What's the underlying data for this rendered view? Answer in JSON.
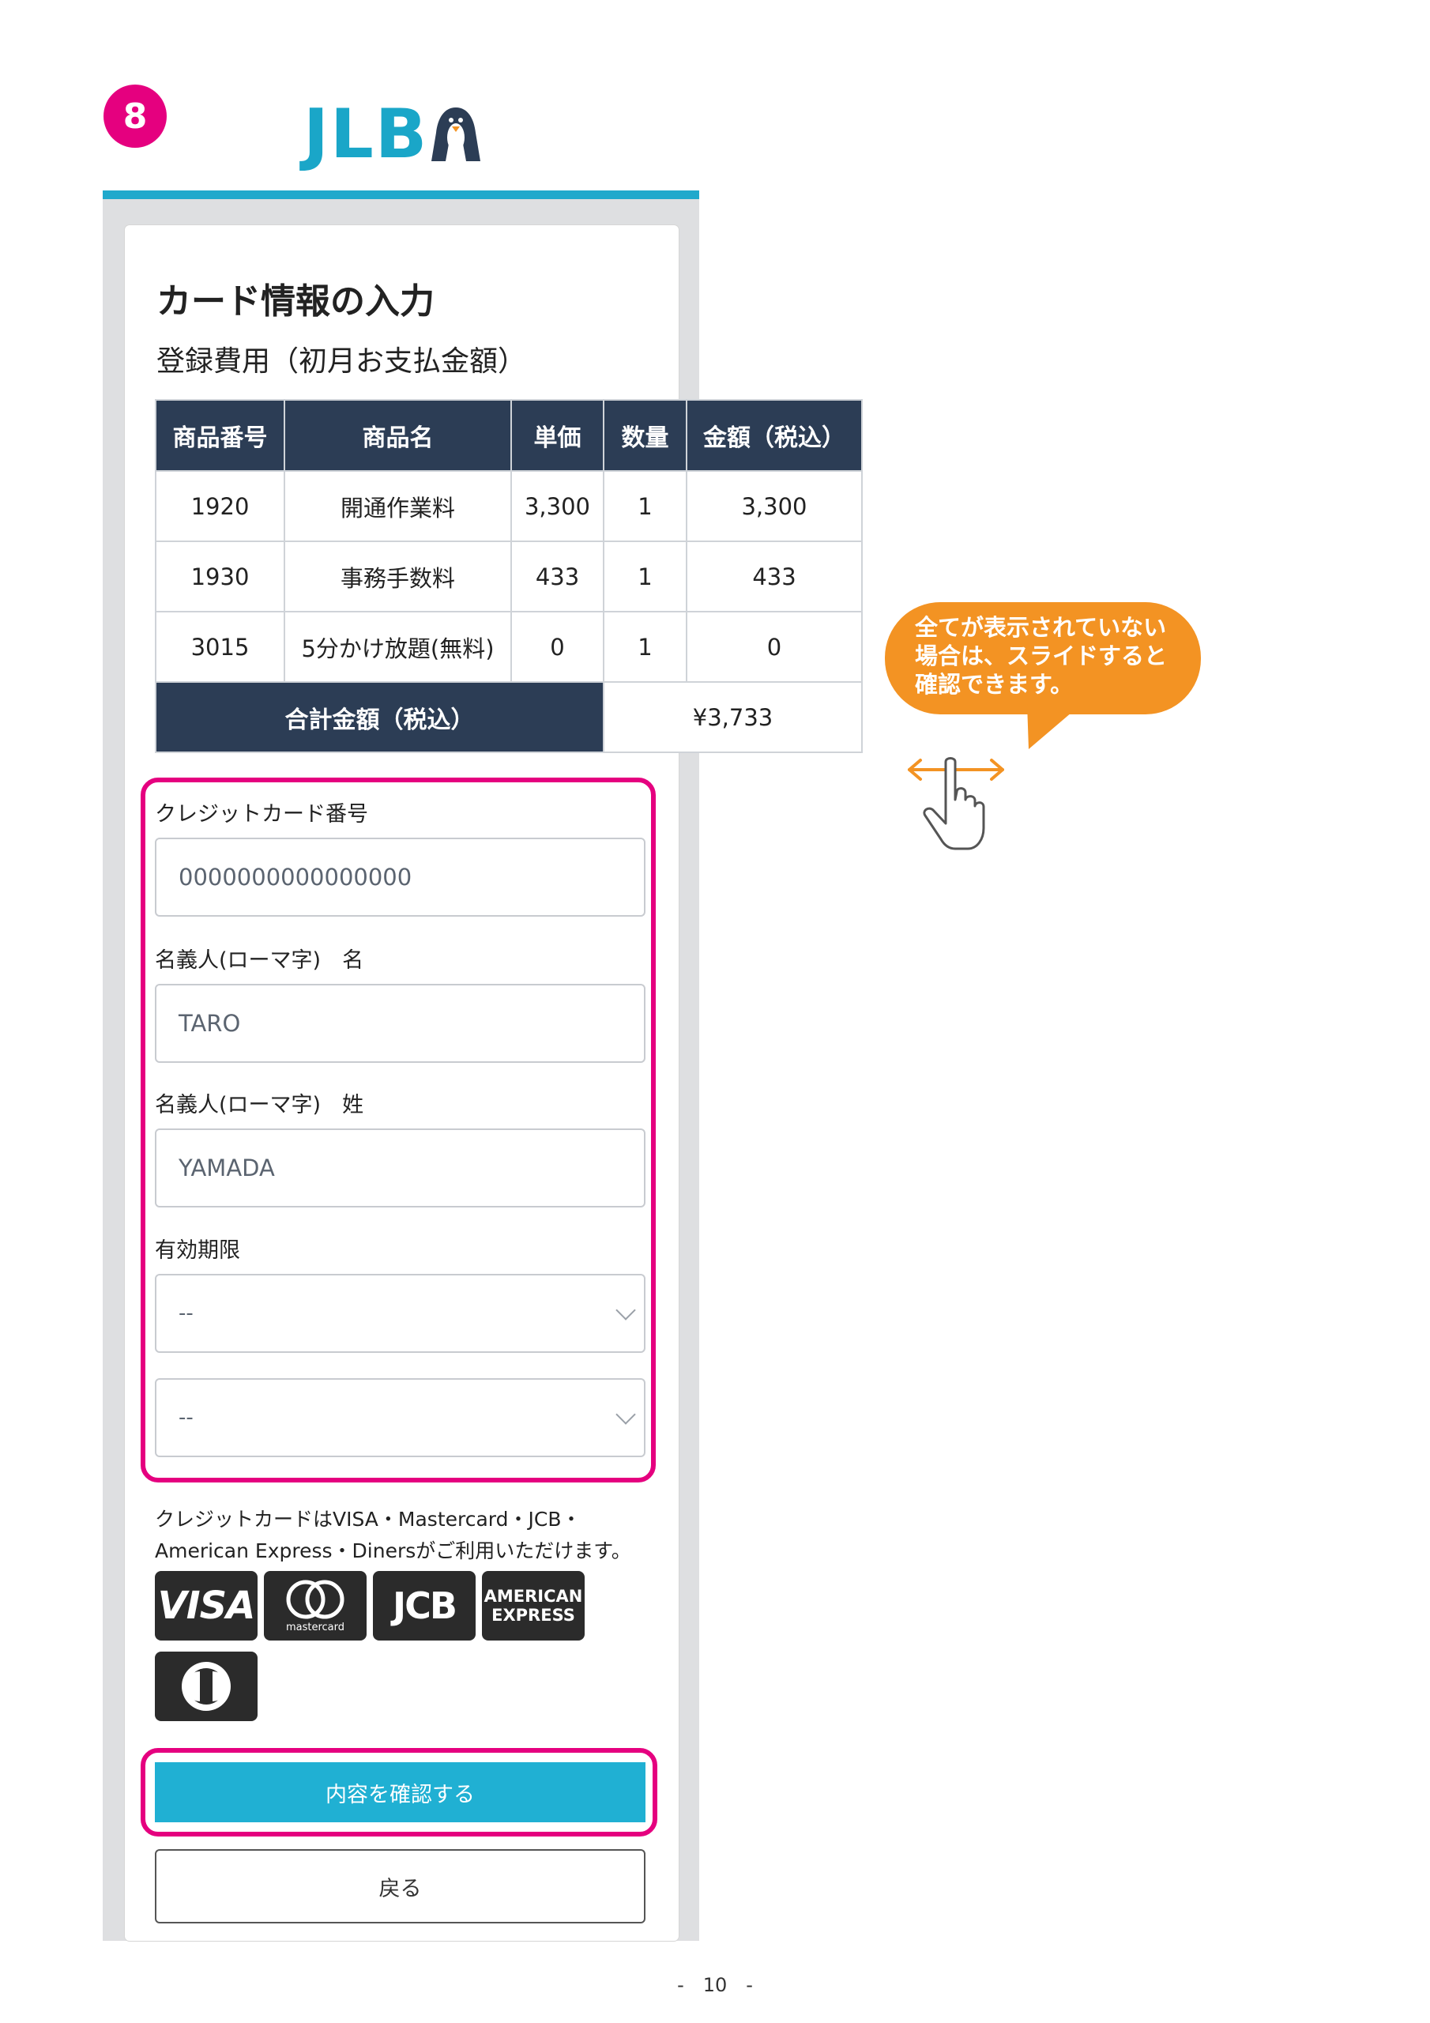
{
  "step": {
    "number": "8"
  },
  "logo": {
    "text": "JLB"
  },
  "page": {
    "title": "カード情報の入力",
    "section_title": "登録費用（初月お支払金額）"
  },
  "table": {
    "headers": [
      "商品番号",
      "商品名",
      "単価",
      "数量",
      "金額（税込）"
    ],
    "rows": [
      [
        "1920",
        "開通作業料",
        "3,300",
        "1",
        "3,300"
      ],
      [
        "1930",
        "事務手数料",
        "433",
        "1",
        "433"
      ],
      [
        "3015",
        "5分かけ放題(無料)",
        "0",
        "1",
        "0"
      ]
    ],
    "total_label": "合計金額（税込）",
    "total_value": "¥3,733"
  },
  "form": {
    "card_number_label": "クレジットカード番号",
    "card_number_placeholder": "0000000000000000",
    "first_name_label": "名義人(ローマ字)　名",
    "first_name_placeholder": "TARO",
    "last_name_label": "名義人(ローマ字)　姓",
    "last_name_placeholder": "YAMADA",
    "expiry_label": "有効期限",
    "expiry_month_value": "--",
    "expiry_year_value": "--"
  },
  "card_note": {
    "line1": "クレジットカードはVISA・Mastercard・JCB・",
    "line2": "American Express・Dinersがご利用いただけます。"
  },
  "brands": {
    "visa": "VISA",
    "mastercard": "mastercard",
    "jcb": "JCB",
    "amex_line1": "AMERICAN",
    "amex_line2": "EXPRESS"
  },
  "buttons": {
    "confirm": "内容を確認する",
    "back": "戻る"
  },
  "callout": {
    "line1": "全てが表示されていない",
    "line2": "場合は、スライドすると",
    "line3": "確認できます。"
  },
  "footer": {
    "page_number": "-　10　-"
  },
  "colors": {
    "accent_magenta": "#e5007f",
    "brand_cyan": "#1aa6c8",
    "table_header": "#2c3d55",
    "button_cyan": "#20b0d3",
    "callout_orange": "#f39323"
  }
}
